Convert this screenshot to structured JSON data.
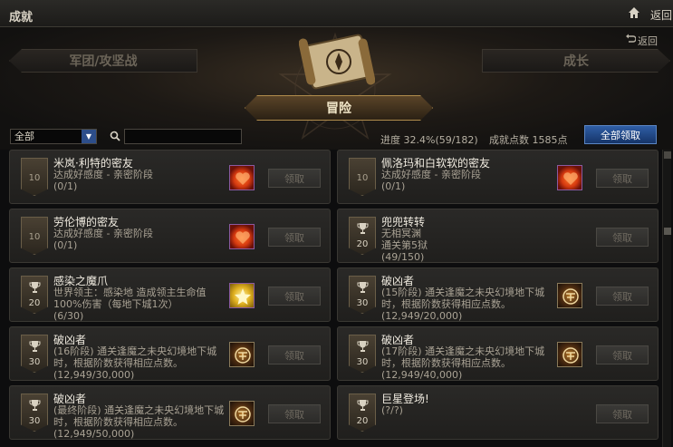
{
  "window": {
    "title": "成就",
    "back_label": "返回"
  },
  "header": {
    "back_label": "返回",
    "tabs": {
      "left": "军团/攻坚战",
      "center": "冒险",
      "right": "成长"
    }
  },
  "filter": {
    "select_value": "全部",
    "search_value": "",
    "progress": "进度 32.4%(59/182)",
    "points": "成就点数 1585点",
    "claim_all": "全部领取"
  },
  "achievements": [
    {
      "title": "米岚·利特的密友",
      "desc": "达成好感度 - 亲密阶段",
      "desc2": "(0/1)",
      "badge": "10",
      "badge_type": "level",
      "reward": "heart-icon",
      "button": "领取"
    },
    {
      "title": "佩洛玛和白软软的密友",
      "desc": "达成好感度 - 亲密阶段",
      "desc2": "(0/1)",
      "badge": "10",
      "badge_type": "level",
      "reward": "heart-icon",
      "button": "领取"
    },
    {
      "title": "劳伦博的密友",
      "desc": "达成好感度 - 亲密阶段",
      "desc2": "(0/1)",
      "badge": "10",
      "badge_type": "level",
      "reward": "heart-icon",
      "button": "领取"
    },
    {
      "title": "兜兜转转",
      "desc": "无相冥渊\n通关第5狱",
      "desc2": "(49/150)",
      "badge": "20",
      "badge_type": "trophy",
      "reward": "",
      "button": "领取"
    },
    {
      "title": "感染之魔爪",
      "desc": "世界领主：感染地    造成领主生命值100%伤害（每地下城1次）",
      "desc2": "(6/30)",
      "badge": "20",
      "badge_type": "trophy",
      "reward": "star-icon",
      "button": "领取"
    },
    {
      "title": "破凶者",
      "desc": "(15阶段) 通关逢魔之未央幻境地下城时，根据阶数获得相应点数。",
      "desc2": "(12,949/20,000)",
      "badge": "30",
      "badge_type": "trophy",
      "reward": "rune-icon",
      "button": "领取"
    },
    {
      "title": "破凶者",
      "desc": "(16阶段) 通关逢魔之未央幻境地下城时，根据阶数获得相应点数。",
      "desc2": "(12,949/30,000)",
      "badge": "30",
      "badge_type": "trophy",
      "reward": "rune-icon",
      "button": "领取"
    },
    {
      "title": "破凶者",
      "desc": "(17阶段) 通关逢魔之未央幻境地下城时，根据阶数获得相应点数。",
      "desc2": "(12,949/40,000)",
      "badge": "30",
      "badge_type": "trophy",
      "reward": "rune-icon",
      "button": "领取"
    },
    {
      "title": "破凶者",
      "desc": "(最终阶段) 通关逢魔之未央幻境地下城时，根据阶数获得相应点数。",
      "desc2": "(12,949/50,000)",
      "badge": "30",
      "badge_type": "trophy",
      "reward": "rune-icon",
      "button": "领取"
    },
    {
      "title": "巨星登场!",
      "desc": "",
      "desc2": "(?/?)",
      "badge": "20",
      "badge_type": "trophy",
      "reward": "",
      "button": "领取"
    }
  ],
  "colors": {
    "accent_blue": "#2f5ea6",
    "gold": "#b08c4c",
    "bg": "#0d0d0e"
  }
}
